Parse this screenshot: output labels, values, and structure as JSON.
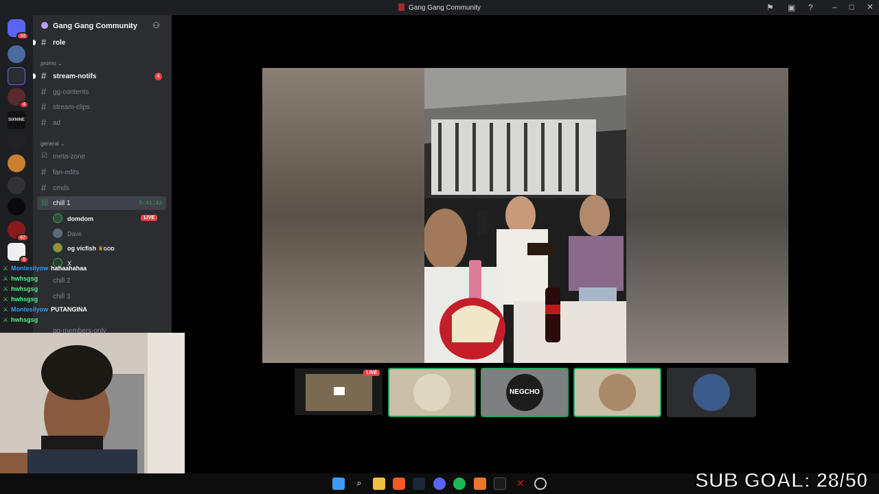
{
  "window": {
    "title": "Gang Gang Community"
  },
  "server_rail": {
    "badges": [
      "33",
      "4",
      "87",
      "6"
    ],
    "labels": [
      "SIXNINE"
    ]
  },
  "server": {
    "name": "Gang Gang Community"
  },
  "channels": {
    "top": [
      {
        "name": "role"
      }
    ],
    "promo_label": "promo",
    "promo": [
      {
        "name": "stream-notifs",
        "badge": "4"
      },
      {
        "name": "gg-contents"
      },
      {
        "name": "stream-clips"
      },
      {
        "name": "ad"
      }
    ],
    "general_label": "general",
    "general": [
      {
        "name": "meta-zone"
      },
      {
        "name": "fan-edits"
      },
      {
        "name": "cmds"
      }
    ],
    "voice": {
      "name": "chill 1",
      "timer": "5:41:42"
    },
    "voice_users": [
      {
        "name": "domdom",
        "live": "LIVE"
      },
      {
        "name": "Dave"
      },
      {
        "name": "og vicfish",
        "tag": "GOD"
      },
      {
        "name": "X"
      }
    ],
    "more": [
      {
        "name": "chill 2"
      },
      {
        "name": "chill 3"
      },
      {
        "name": "gg-members-only"
      }
    ]
  },
  "chat": [
    {
      "user": "Montesilyow",
      "msg": "hahaahahaa",
      "color": "blue"
    },
    {
      "user": "hwhsgsg",
      "msg": ""
    },
    {
      "user": "hwhsgsg",
      "msg": ""
    },
    {
      "user": "hwhsgsg",
      "msg": ""
    },
    {
      "user": "Montesilyow",
      "msg": "PUTANGINA",
      "color": "blue"
    },
    {
      "user": "hwhsgsg",
      "msg": ""
    }
  ],
  "tiles": {
    "live_label": "LIVE",
    "tile3_text": "NEGCHO"
  },
  "overlay": {
    "sub_goal": "SUB GOAL: 28/50"
  }
}
